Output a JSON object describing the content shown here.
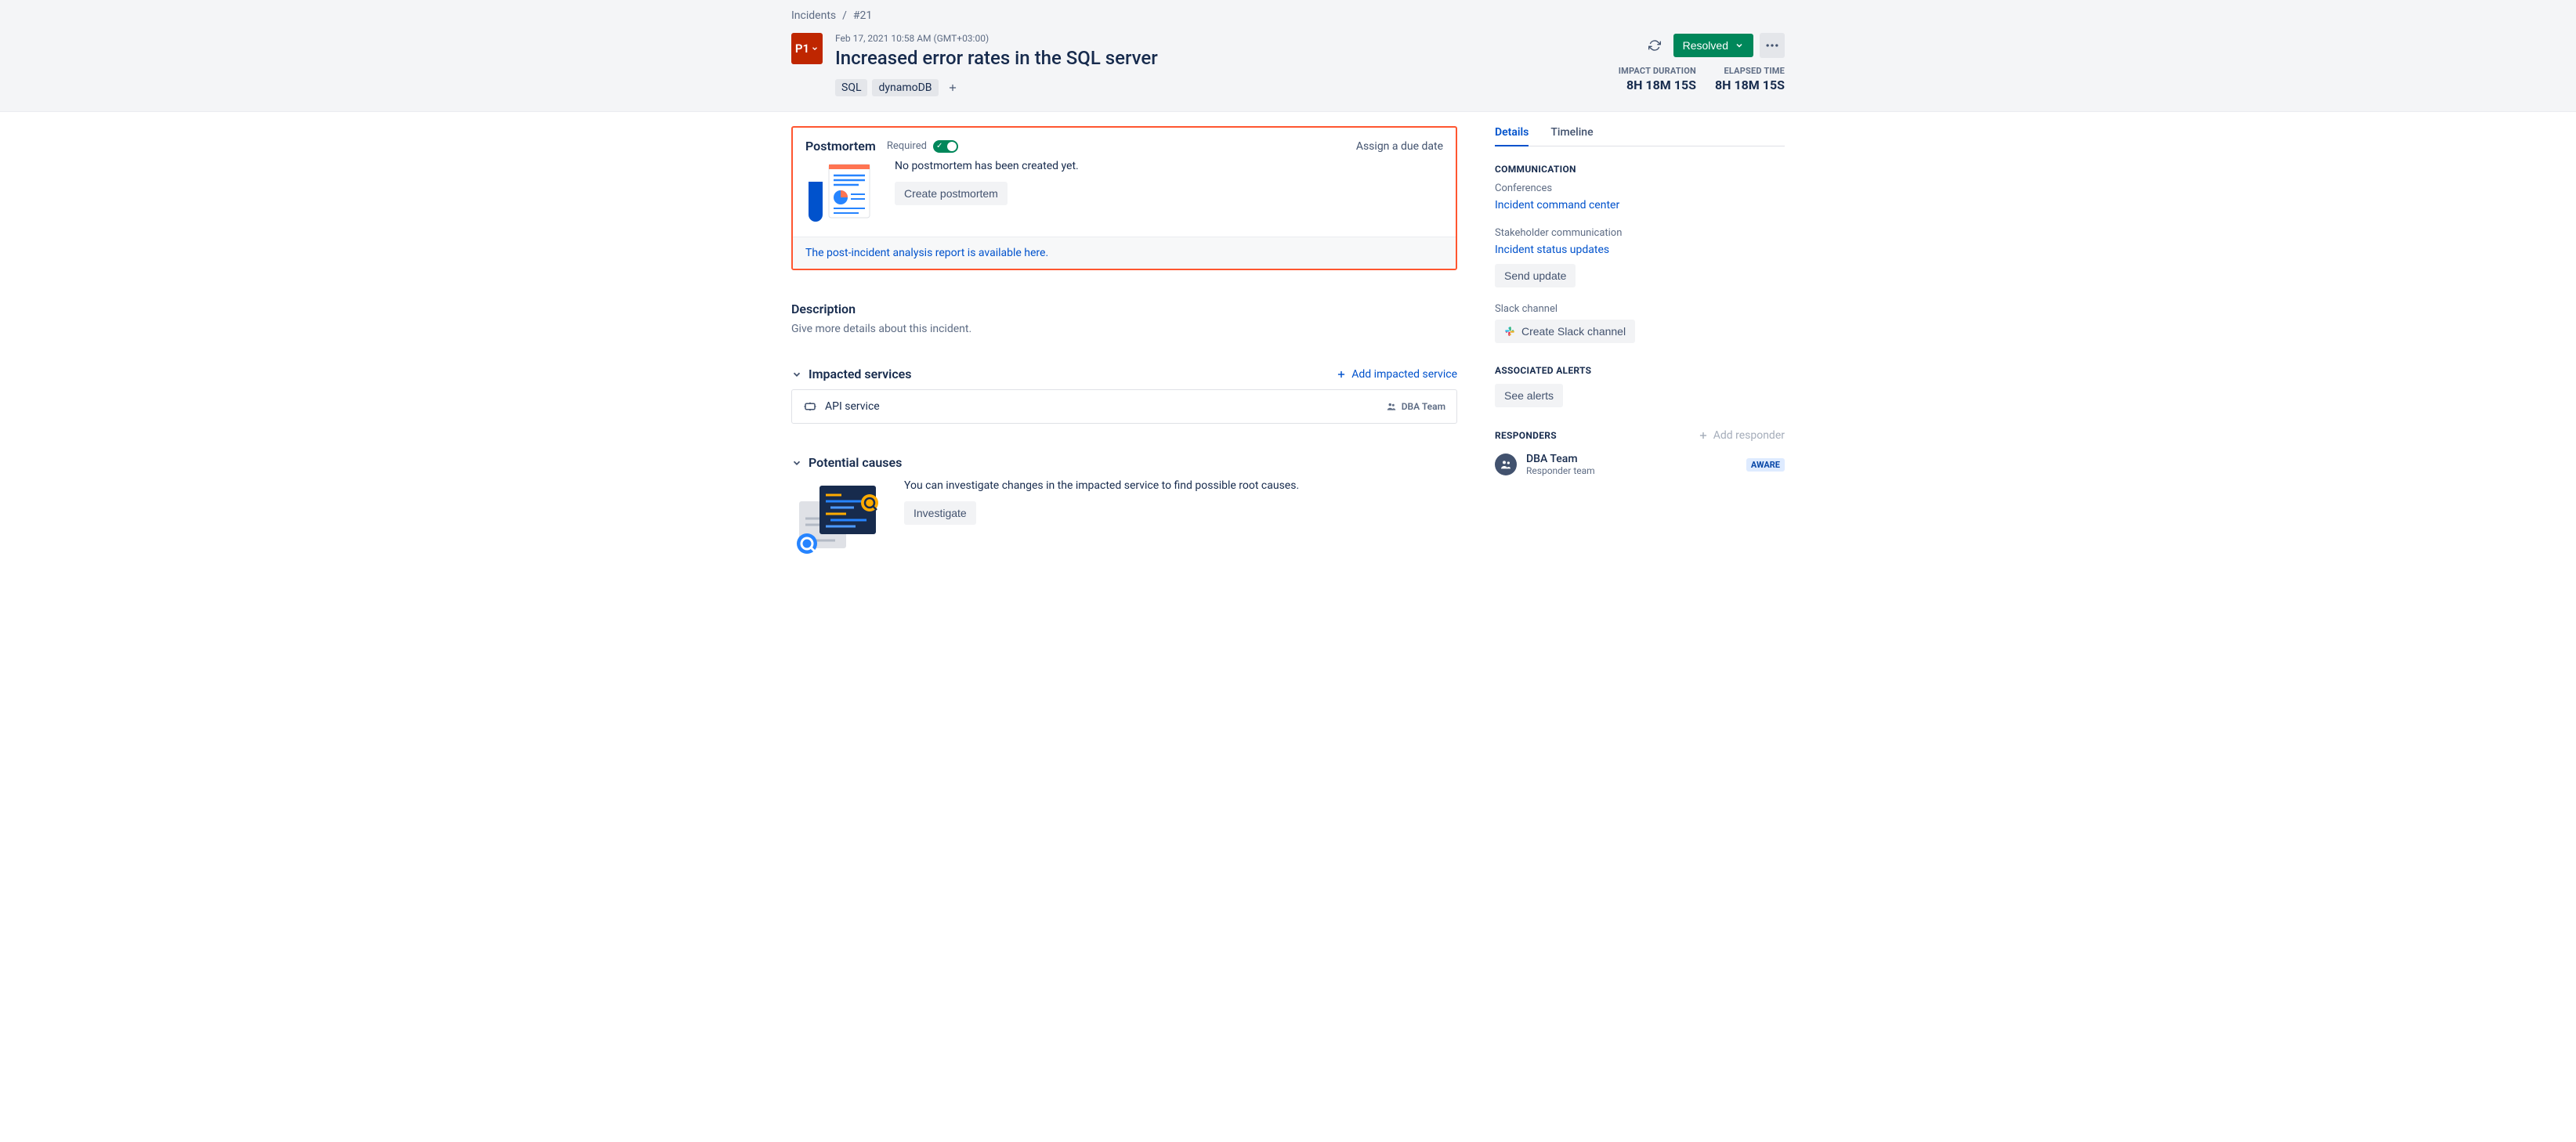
{
  "breadcrumbs": {
    "root": "Incidents",
    "id": "#21"
  },
  "header": {
    "priority": "P1",
    "timestamp": "Feb 17, 2021 10:58 AM (GMT+03:00)",
    "title": "Increased error rates in the SQL server",
    "tags": [
      "SQL",
      "dynamoDB"
    ],
    "status": "Resolved",
    "impact_duration_label": "IMPACT DURATION",
    "impact_duration_value": "8H 18M 15S",
    "elapsed_time_label": "ELAPSED TIME",
    "elapsed_time_value": "8H 18M 15S"
  },
  "postmortem": {
    "heading": "Postmortem",
    "required_label": "Required",
    "assign_due": "Assign a due date",
    "no_pm_text": "No postmortem has been created yet.",
    "create_btn": "Create postmortem",
    "footer_link": "The post-incident analysis report is available here."
  },
  "description": {
    "heading": "Description",
    "placeholder": "Give more details about this incident."
  },
  "impacted": {
    "heading": "Impacted services",
    "add_link": "Add impacted service",
    "services": [
      {
        "name": "API service",
        "team": "DBA Team"
      }
    ]
  },
  "causes": {
    "heading": "Potential causes",
    "text": "You can investigate changes in the impacted service to find possible root causes.",
    "btn": "Investigate"
  },
  "sidebar": {
    "tabs": {
      "details": "Details",
      "timeline": "Timeline"
    },
    "communication": {
      "heading": "COMMUNICATION",
      "conferences_label": "Conferences",
      "conferences_link": "Incident command center",
      "stakeholder_label": "Stakeholder communication",
      "stakeholder_link": "Incident status updates",
      "send_update_btn": "Send update",
      "slack_label": "Slack channel",
      "slack_btn": "Create Slack channel"
    },
    "alerts": {
      "heading": "ASSOCIATED ALERTS",
      "btn": "See alerts"
    },
    "responders": {
      "heading": "RESPONDERS",
      "add": "Add responder",
      "items": [
        {
          "name": "DBA Team",
          "role": "Responder team",
          "status": "AWARE"
        }
      ]
    }
  }
}
